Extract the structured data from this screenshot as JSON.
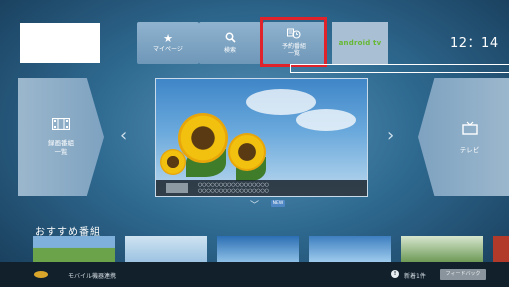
{
  "topbar": {
    "mypage_label": "マイページ",
    "search_label": "検索",
    "recorded_label": "予約番組\n一覧",
    "brand_label": "android tv",
    "clock": "12：14"
  },
  "side": {
    "left_label": "録画番組\n一覧",
    "right_label": "テレビ"
  },
  "main": {
    "caption_line1": "○○○○○○○○○○○○○○○○○",
    "caption_line2": "○○○○○○○○○○○○○○○○○",
    "new_badge": "NEW"
  },
  "recommended": {
    "title": "おすすめ番組"
  },
  "bottom": {
    "mobile_label": "モバイル機器連携",
    "notice_label": "新着1件",
    "feedback_label": "フィードバック"
  },
  "colors": {
    "highlight": "#e0222b",
    "brand_green": "#66b832"
  }
}
